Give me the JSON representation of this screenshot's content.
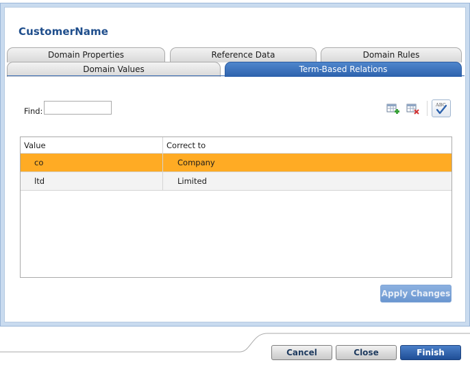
{
  "dialog": {
    "title": "CustomerName"
  },
  "tabs": {
    "top_row": [
      "Domain Properties",
      "Reference Data",
      "Domain Rules"
    ],
    "bottom_row": [
      "Domain Values",
      "Term-Based Relations"
    ],
    "active": "Term-Based Relations"
  },
  "find": {
    "label": "Find:",
    "value": "",
    "placeholder": ""
  },
  "toolbar": {
    "icons": [
      "add-row-icon",
      "delete-row-icon",
      "spell-check-icon"
    ]
  },
  "grid": {
    "columns": [
      "Value",
      "Correct to"
    ],
    "rows": [
      {
        "value": "co",
        "correct_to": "Company",
        "selected": true
      },
      {
        "value": "ltd",
        "correct_to": "Limited",
        "selected": false
      }
    ]
  },
  "buttons": {
    "apply": "Apply Changes",
    "cancel": "Cancel",
    "close": "Close",
    "finish": "Finish"
  },
  "colors": {
    "accent_blue": "#2d62ad",
    "selected_row": "#ffab24",
    "title": "#1f4e8c"
  }
}
